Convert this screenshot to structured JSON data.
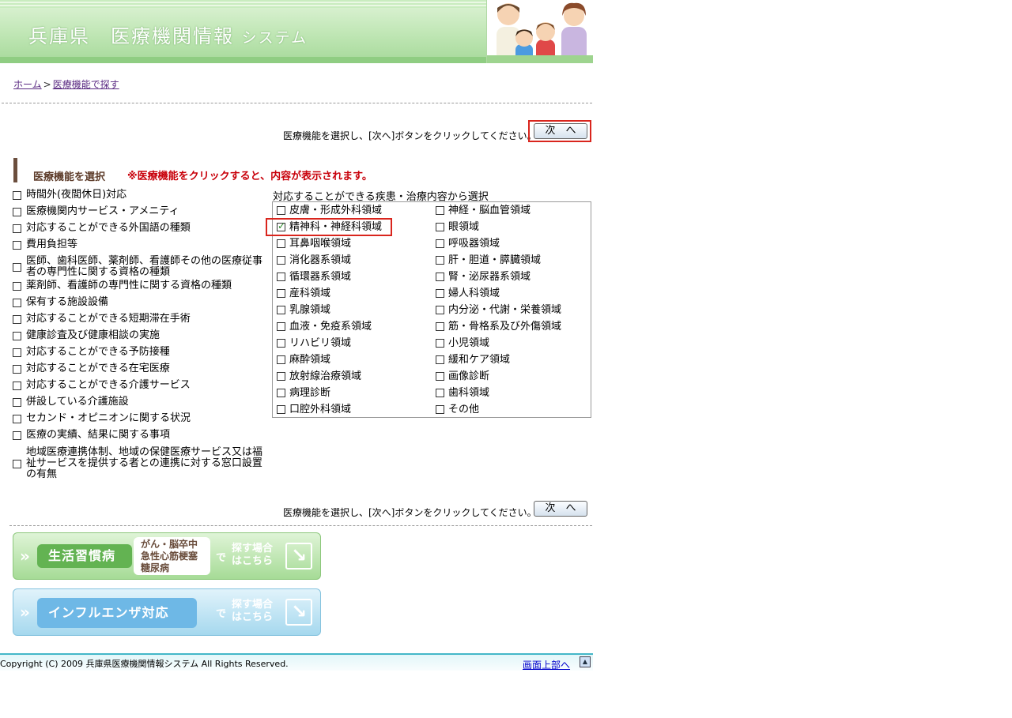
{
  "header": {
    "title_main": "兵庫県　医療機関情報",
    "title_sub": "システム"
  },
  "breadcrumb": {
    "home": "ホーム",
    "separator": ">",
    "current": "医療機能で探す"
  },
  "instruction": "医療機能を選択し、[次へ]ボタンをクリックしてください。→",
  "next_label": "次　へ",
  "section": {
    "title": "医療機能を選択",
    "note": "※医療機能をクリックすると、内容が表示されます。"
  },
  "left_items": [
    {
      "label": "時間外(夜間休日)対応",
      "checked": false
    },
    {
      "label": "医療機関内サービス・アメニティ",
      "checked": false
    },
    {
      "label": "対応することができる外国語の種類",
      "checked": false
    },
    {
      "label": "費用負担等",
      "checked": false
    },
    {
      "label": "医師、歯科医師、薬剤師、看護師その他の医療従事者の専門性に関する資格の種類",
      "checked": false
    },
    {
      "label": "薬剤師、看護師の専門性に関する資格の種類",
      "checked": false
    },
    {
      "label": "保有する施設設備",
      "checked": false
    },
    {
      "label": "対応することができる短期滞在手術",
      "checked": false
    },
    {
      "label": "健康診査及び健康相談の実施",
      "checked": false
    },
    {
      "label": "対応することができる予防接種",
      "checked": false
    },
    {
      "label": "対応することができる在宅医療",
      "checked": false
    },
    {
      "label": "対応することができる介護サービス",
      "checked": false
    },
    {
      "label": "併設している介護施設",
      "checked": false
    },
    {
      "label": "セカンド・オピニオンに関する状況",
      "checked": false
    },
    {
      "label": "医療の実績、結果に関する事項",
      "checked": false
    },
    {
      "label": "地域医療連携体制、地域の保健医療サービス又は福祉サービスを提供する者との連携に対する窓口設置の有無",
      "checked": false
    }
  ],
  "right_heading": "対応することができる疾患・治療内容から選択",
  "right_col1": [
    {
      "label": "皮膚・形成外科領域",
      "checked": false
    },
    {
      "label": "精神科・神経科領域",
      "checked": true
    },
    {
      "label": "耳鼻咽喉領域",
      "checked": false
    },
    {
      "label": "消化器系領域",
      "checked": false
    },
    {
      "label": "循環器系領域",
      "checked": false
    },
    {
      "label": "産科領域",
      "checked": false
    },
    {
      "label": "乳腺領域",
      "checked": false
    },
    {
      "label": "血液・免疫系領域",
      "checked": false
    },
    {
      "label": "リハビリ領域",
      "checked": false
    },
    {
      "label": "麻酔領域",
      "checked": false
    },
    {
      "label": "放射線治療領域",
      "checked": false
    },
    {
      "label": "病理診断",
      "checked": false
    },
    {
      "label": "口腔外科領域",
      "checked": false
    }
  ],
  "right_col2": [
    {
      "label": "神経・脳血管領域",
      "checked": false
    },
    {
      "label": "眼領域",
      "checked": false
    },
    {
      "label": "呼吸器領域",
      "checked": false
    },
    {
      "label": "肝・胆道・膵臓領域",
      "checked": false
    },
    {
      "label": "腎・泌尿器系領域",
      "checked": false
    },
    {
      "label": "婦人科領域",
      "checked": false
    },
    {
      "label": "内分泌・代謝・栄養領域",
      "checked": false
    },
    {
      "label": "筋・骨格系及び外傷領域",
      "checked": false
    },
    {
      "label": "小児領域",
      "checked": false
    },
    {
      "label": "緩和ケア領域",
      "checked": false
    },
    {
      "label": "画像診断",
      "checked": false
    },
    {
      "label": "歯科領域",
      "checked": false
    },
    {
      "label": "その他",
      "checked": false
    }
  ],
  "banner_lifestyle": {
    "label": "生活習慣病",
    "diseases": [
      "がん・脳卒中",
      "急性心筋梗塞",
      "糖尿病"
    ],
    "de": "で",
    "search_line1": "探す場合",
    "search_line2": "はこちら"
  },
  "banner_flu": {
    "label": "インフルエンザ対応",
    "de": "で",
    "search_line1": "探す場合",
    "search_line2": "はこちら"
  },
  "footer": {
    "copyright": "Copyright (C) 2009 兵庫県医療機関情報システム All Rights Reserved.",
    "to_top": "画面上部へ"
  },
  "colors": {
    "accent_red": "#d9251d",
    "note_red": "#c8000a",
    "header_green": "#a6d99a",
    "footer_line": "#43b7c8"
  }
}
